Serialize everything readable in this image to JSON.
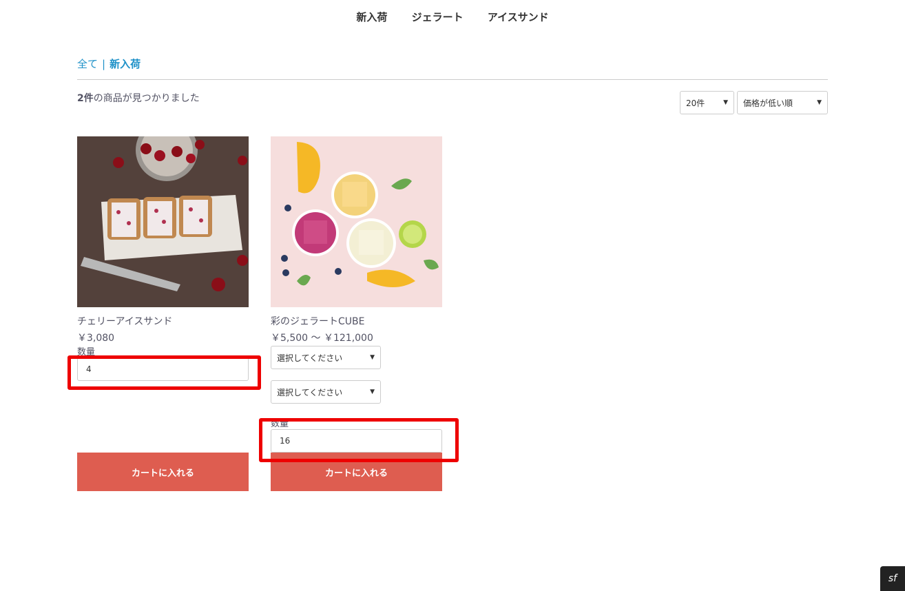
{
  "nav": {
    "items": [
      "新入荷",
      "ジェラート",
      "アイスサンド"
    ]
  },
  "breadcrumb": {
    "all": "全て",
    "separator": "|",
    "current": "新入荷"
  },
  "results": {
    "count": "2件",
    "suffix": "の商品が見つかりました"
  },
  "controls": {
    "per_page": "20件",
    "sort": "価格が低い順"
  },
  "products": [
    {
      "name": "チェリーアイスサンド",
      "price": "￥3,080",
      "qty_label": "数量",
      "qty": "4",
      "cart_label": "カートに入れる"
    },
    {
      "name": "彩のジェラートCUBE",
      "price": "￥5,500 ～ ￥121,000",
      "option1": "選択してください",
      "option2": "選択してください",
      "qty_label": "数量",
      "qty": "16",
      "cart_label": "カートに入れる"
    }
  ],
  "colors": {
    "accent": "#de5d50",
    "link": "#1e91c8",
    "highlight": "#ee0000"
  },
  "icons": {
    "chevron": "chevron-down-icon",
    "symfony": "symfony-icon"
  }
}
